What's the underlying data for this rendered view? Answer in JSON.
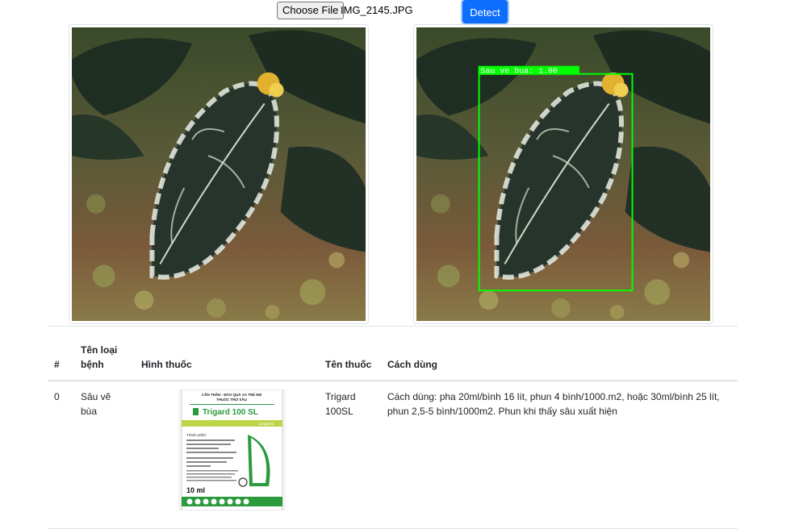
{
  "upload": {
    "choose_label": "Choose File",
    "file_name": "IMG_2145.JPG",
    "detect_label": "Detect"
  },
  "detection": {
    "label": "Sau ve bua: 1.00",
    "box_color": "#00ff00"
  },
  "table": {
    "headers": {
      "index": "#",
      "disease": "Tên loại bệnh",
      "drug_image": "Hình thuốc",
      "drug_name": "Tên thuốc",
      "usage": "Cách dùng"
    },
    "rows": [
      {
        "index": "0",
        "disease": "Sâu vẽ bùa",
        "drug_name": "Trigard 100SL",
        "usage": "Cách dùng: pha 20ml/bình 16 lít, phun 4 bình/1000.m2, hoặc 30ml/bình 25 lít, phun 2,5-5 bình/1000m2. Phun khi thấy sâu xuất hiện",
        "package": {
          "warning": "CẨN THẬN - ĐÀO QUÀ XA TRẺ EM",
          "category": "THUỐC TRỪ SÂU",
          "brand": "Trigard 100 SL",
          "maker": "syngenta",
          "ingredients_label": "Thành phần:",
          "volume": "10 ml"
        }
      }
    ]
  },
  "colors": {
    "primary": "#0d6efd",
    "leaf_dark": "#1e2a22",
    "package_green": "#2a9a3c"
  }
}
